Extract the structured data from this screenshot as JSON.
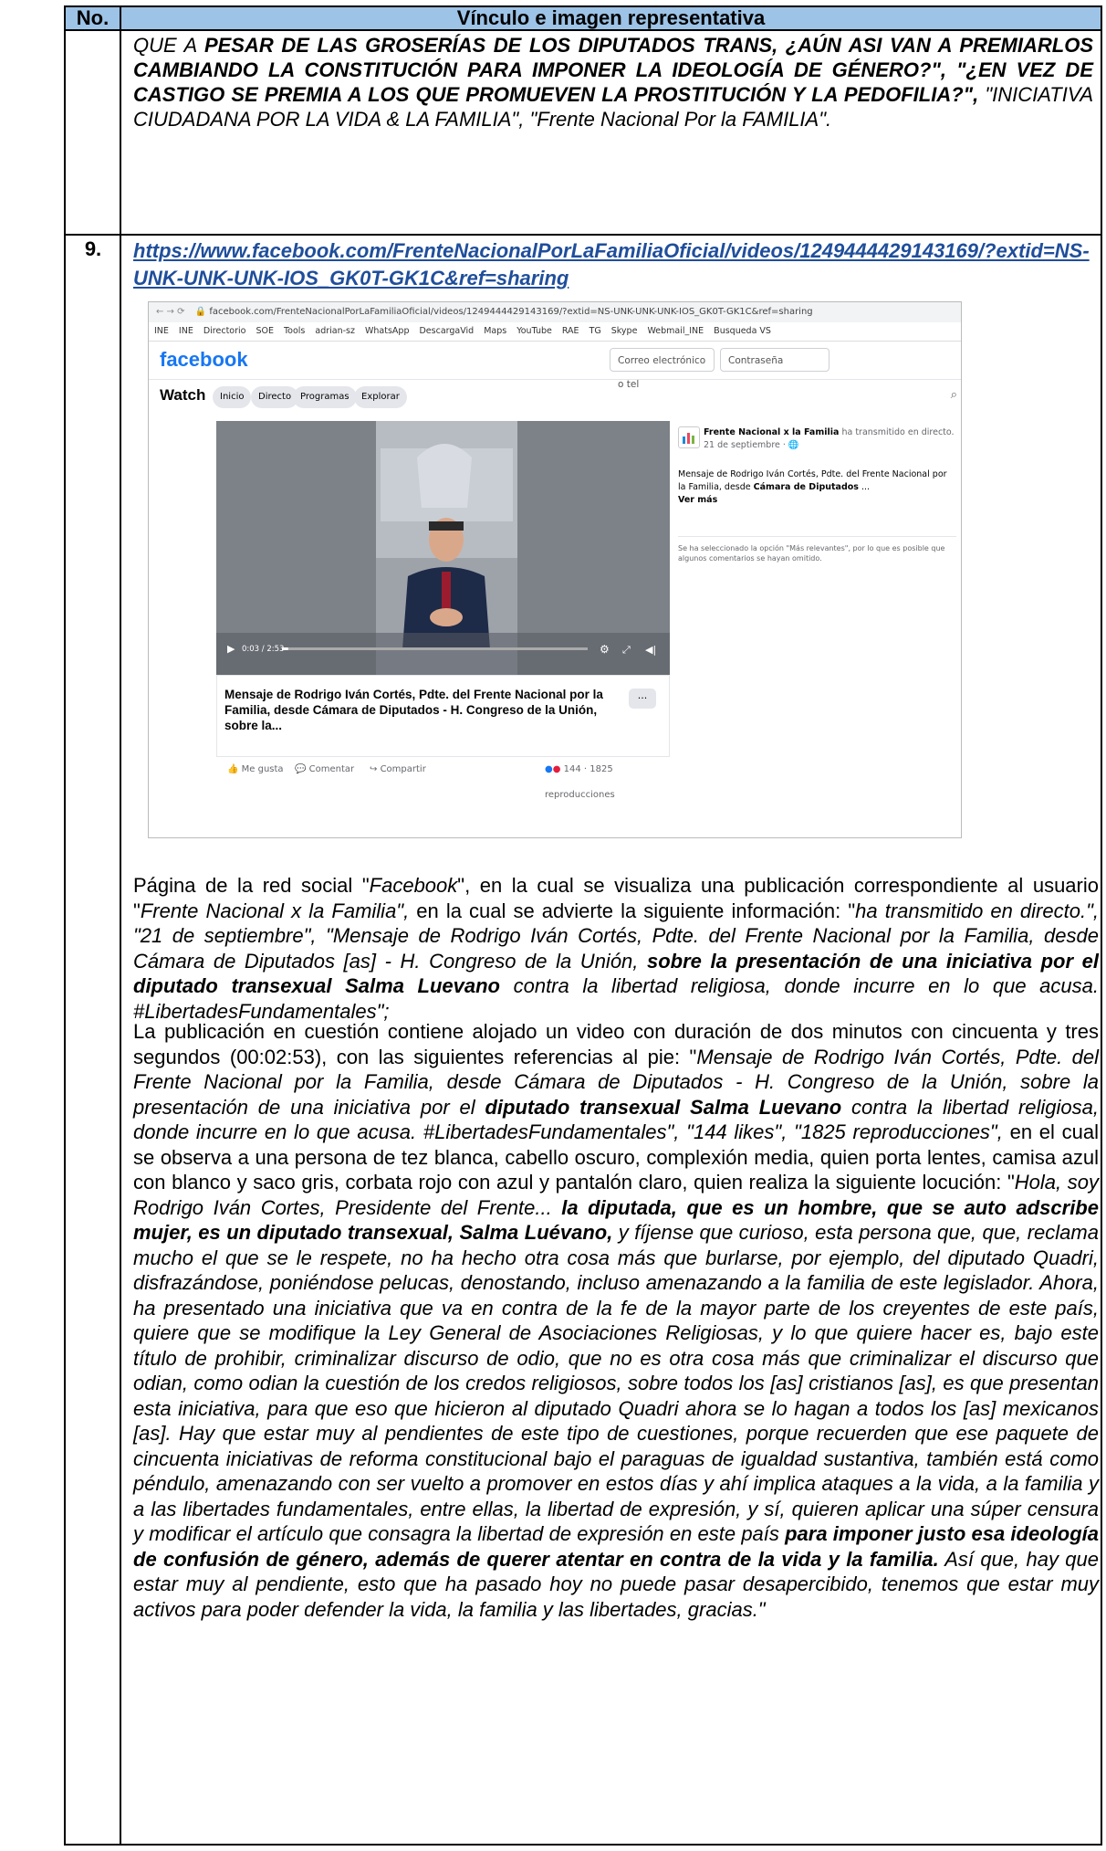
{
  "header": {
    "col1": "No.",
    "col2": "Vínculo e imagen representativa"
  },
  "previous_row_text": {
    "t1": "QUE A ",
    "t2": "PESAR DE LAS GROSERÍAS DE LOS DIPUTADOS TRANS, ¿AÚN ASI VAN A PREMIARLOS CAMBIANDO LA CONSTITUCIÓN PARA IMPONER LA IDEOLOGÍA DE GÉNERO?\", \"¿EN VEZ DE CASTIGO SE PREMIA A LOS QUE PROMUEVEN LA PROSTITUCIÓN Y LA PEDOFILIA?\",",
    "t3": " \"INICIATIVA CIUDADANA POR LA VIDA & LA FAMILIA\", \"Frente Nacional Por la FAMILIA\"."
  },
  "row": {
    "number": "9.",
    "link": "https://www.facebook.com/FrenteNacionalPorLaFamiliaOficial/videos/1249444429143169/?extid=NS-UNK-UNK-UNK-IOS_GK0T-GK1C&ref=sharing"
  },
  "screenshot": {
    "address": "facebook.com/FrenteNacionalPorLaFamiliaOficial/videos/1249444429143169/?extid=NS-UNK-UNK-UNK-IOS_GK0T-GK1C&ref=sharing",
    "bookmarks": [
      "INE",
      "INE",
      "Directorio",
      "SOE",
      "Tools",
      "adrian-sz",
      "WhatsApp",
      "DescargaVid",
      "Maps",
      "YouTube",
      "RAE",
      "TG",
      "Skype",
      "Webmail_INE",
      "Busqueda VS"
    ],
    "logo": "facebook",
    "email_placeholder": "Correo electrónico o tel",
    "password_placeholder": "Contraseña",
    "watch": "Watch",
    "tabs": [
      "Inicio",
      "Directo",
      "Programas",
      "Explorar"
    ],
    "page_name": "Frente Nacional x la Familia",
    "broadcast": "ha transmitido en directo.",
    "date": "21 de septiembre · ",
    "post_text_a": "Mensaje de Rodrigo Iván Cortés, Pdte. del Frente Nacional por la Familia, desde ",
    "post_text_b": "Cámara de Diputados",
    "post_text_c": " ...",
    "see_more": "Ver más",
    "comments_note": "Se ha seleccionado la opción \"Más relevantes\", por lo que es posible que algunos comentarios se hayan omitido.",
    "time": "0:03 / 2:53",
    "video_title": "Mensaje de Rodrigo Iván Cortés, Pdte. del Frente Nacional por la Familia, desde Cámara de Diputados - H. Congreso de la Unión, sobre la...",
    "more": "···",
    "like": "Me gusta",
    "comment": "Comentar",
    "share": "Compartir",
    "reactions": "144 · 1825 reproducciones",
    "progress": 0.02
  },
  "p1": {
    "a": "Página de la red social \"",
    "b": "Facebook",
    "c": "\", en la cual se visualiza una publicación correspondiente al usuario \"",
    "d": "Frente Nacional x la Familia\",",
    "e": " en la cual se advierte la siguiente información: \"",
    "f": "ha transmitido en directo.\", \"21 de septiembre\", \"Mensaje de Rodrigo Iván Cortés, Pdte. del Frente Nacional por la Familia, desde Cámara de Diputados [as] - H. Congreso de la Unión, ",
    "g": "sobre la presentación de una iniciativa por el diputado transexual Salma Luevano",
    "h": " contra la libertad religiosa, donde incurre en lo que acusa. #LibertadesFundamentales\";"
  },
  "p2": {
    "a": "La publicación en cuestión contiene alojado un video con duración de dos minutos con cincuenta y tres segundos (00:02:53), con las siguientes referencias al pie: \"",
    "b": "Mensaje de Rodrigo Iván Cortés, Pdte. del Frente Nacional por la Familia, desde Cámara de Diputados - H. Congreso de la Unión, sobre la presentación de una iniciativa por el ",
    "c": "diputado transexual Salma Luevano",
    "d": " contra la libertad religiosa, donde incurre en lo que acusa. #LibertadesFundamentales\", \"144 likes\", \"1825 reproducciones\",",
    "e": " en el cual se observa a una persona de tez blanca, cabello oscuro, complexión media, quien porta lentes, camisa azul con blanco y saco gris, corbata rojo con azul y pantalón claro, quien realiza la siguiente locución: \"",
    "f": "Hola, soy Rodrigo Iván Cortes, Presidente del Frente... ",
    "g": "la diputada, que es un hombre, que se auto adscribe mujer, es un diputado transexual, Salma Luévano,",
    "h": " y fíjense que curioso, esta persona que, que, reclama mucho el que se le respete, no ha hecho otra cosa más que burlarse, por ejemplo, del diputado Quadri, disfrazándose, poniéndose pelucas, denostando, incluso amenazando a la familia de este legislador. Ahora, ha presentado una iniciativa que va en contra de la fe de la mayor parte de los creyentes de este país, quiere que se modifique la Ley General de Asociaciones Religiosas, y lo que quiere hacer es, bajo este título de prohibir, criminalizar discurso de odio, que no es otra cosa más que criminalizar el discurso que odian, como odian la cuestión de los credos religiosos, sobre todos los [as] cristianos [as], es que presentan esta iniciativa, para que eso que hicieron al diputado Quadri ahora se lo hagan a todos los [as] mexicanos [as]. Hay que estar muy al pendientes de este tipo de cuestiones, porque recuerden que ese paquete de cincuenta iniciativas de reforma constitucional bajo el paraguas de igualdad sustantiva, también está como péndulo, amenazando con ser vuelto a promover en estos días y ahí implica ataques a la vida, a la familia y a las libertades fundamentales, entre ellas, la libertad de expresión, y sí, quieren aplicar una súper censura y modificar el artículo que consagra la libertad de expresión en este país ",
    "i": "para imponer justo esa ideología de confusión de género, además de querer atentar en contra de la vida y la familia.",
    "j": " Así que, hay que estar muy al pendiente, esto que ha pasado hoy no puede pasar desapercibido, tenemos que estar muy activos para poder defender la vida, la familia y las libertades, gracias.\""
  }
}
